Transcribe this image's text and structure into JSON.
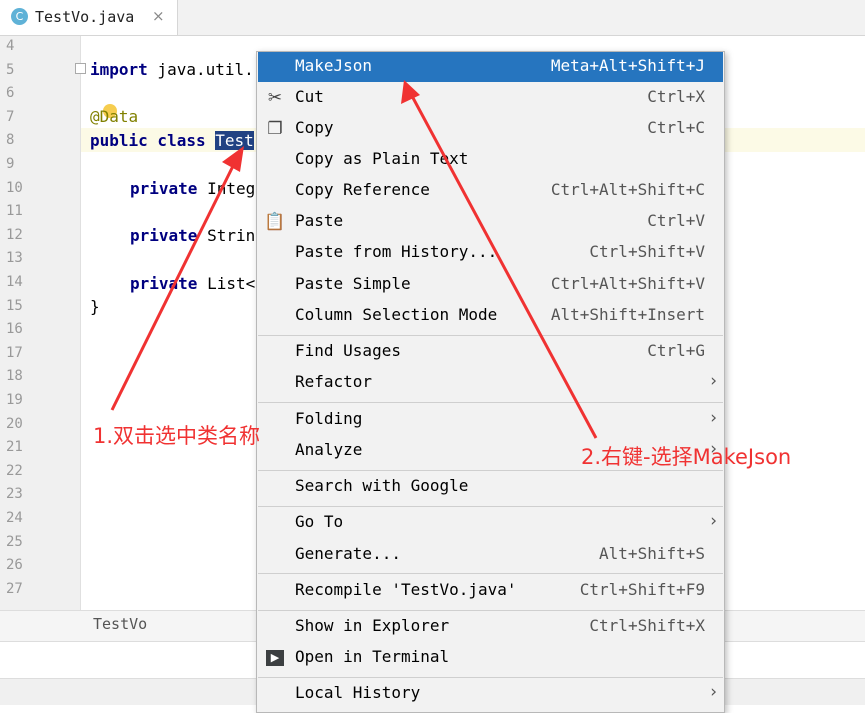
{
  "tab": {
    "icon_letter": "C",
    "title": "TestVo.java",
    "close": "×"
  },
  "gutter": {
    "lines": [
      "4",
      "5",
      "6",
      "7",
      "8",
      "9",
      "10",
      "11",
      "12",
      "13",
      "14",
      "15",
      "16",
      "17",
      "18",
      "19",
      "20",
      "21",
      "22",
      "23",
      "24",
      "25",
      "26",
      "27"
    ]
  },
  "code": {
    "import_kw": "import",
    "import_rest": " java.util.",
    "annotation": "@Data",
    "public_kw": "public",
    "class_kw": " class ",
    "class_name_partial": "Test",
    "field1_kw": "private",
    "field1_rest": " Integ",
    "field2_kw": "private",
    "field2_rest": " Strin",
    "field3_kw": "private",
    "field3_rest": " List<",
    "closing_brace": "}"
  },
  "breadcrumb": "TestVo",
  "menu": {
    "items": [
      {
        "label": "MakeJson",
        "shortcut": "Meta+Alt+Shift+J",
        "icon": "",
        "highlighted": true
      },
      {
        "label": "Cut",
        "shortcut": "Ctrl+X",
        "icon": "scissors-icon",
        "glyph": "✂"
      },
      {
        "label": "Copy",
        "shortcut": "Ctrl+C",
        "icon": "copy-icon",
        "glyph": "❐"
      },
      {
        "label": "Copy as Plain Text",
        "shortcut": "",
        "icon": ""
      },
      {
        "label": "Copy Reference",
        "shortcut": "Ctrl+Alt+Shift+C",
        "icon": ""
      },
      {
        "label": "Paste",
        "shortcut": "Ctrl+V",
        "icon": "clipboard-icon",
        "glyph": "📋"
      },
      {
        "label": "Paste from History...",
        "shortcut": "Ctrl+Shift+V",
        "icon": ""
      },
      {
        "label": "Paste Simple",
        "shortcut": "Ctrl+Alt+Shift+V",
        "icon": ""
      },
      {
        "label": "Column Selection Mode",
        "shortcut": "Alt+Shift+Insert",
        "icon": ""
      },
      {
        "label": "Find Usages",
        "shortcut": "Ctrl+G",
        "icon": ""
      },
      {
        "label": "Refactor",
        "shortcut": "",
        "icon": "",
        "submenu": true
      },
      {
        "label": "Folding",
        "shortcut": "",
        "icon": "",
        "submenu": true
      },
      {
        "label": "Analyze",
        "shortcut": "",
        "icon": ""
      },
      {
        "label": "Search with Google",
        "shortcut": "",
        "icon": ""
      },
      {
        "label": "Go To",
        "shortcut": "",
        "icon": "",
        "submenu": true
      },
      {
        "label": "Generate...",
        "shortcut": "Alt+Shift+S",
        "icon": ""
      },
      {
        "label": "Recompile 'TestVo.java'",
        "shortcut": "Ctrl+Shift+F9",
        "icon": ""
      },
      {
        "label": "Show in Explorer",
        "shortcut": "Ctrl+Shift+X",
        "icon": ""
      },
      {
        "label": "Open in Terminal",
        "shortcut": "",
        "icon": "terminal-icon",
        "glyph": "▶"
      },
      {
        "label": "Local History",
        "shortcut": "",
        "icon": "",
        "submenu": true
      }
    ],
    "chevron": "›"
  },
  "annotations": {
    "step1": "1.双击选中类名称",
    "step2": "2.右键-选择MakeJson"
  },
  "colors": {
    "highlight": "#2675bf",
    "callout": "#f03232",
    "selection": "#214283"
  }
}
